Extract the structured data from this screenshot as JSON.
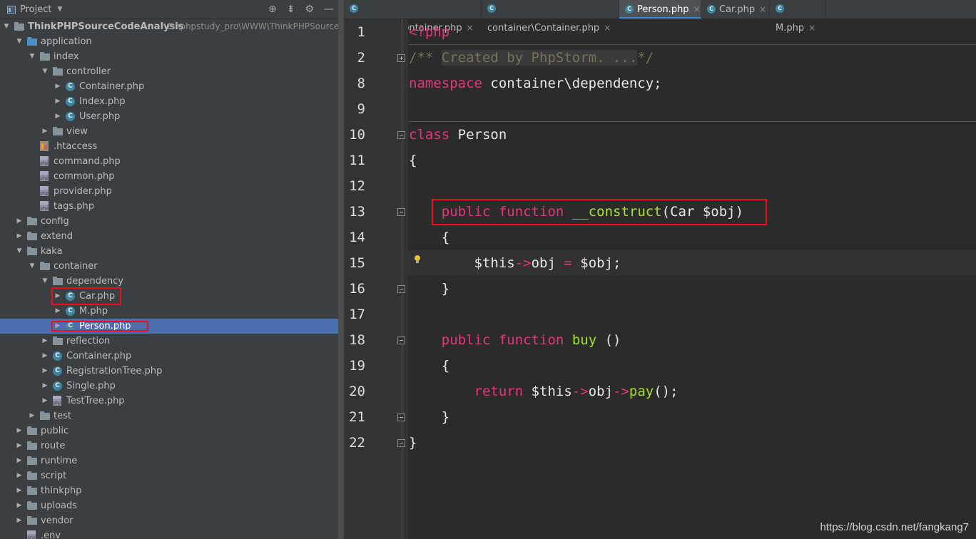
{
  "panel": {
    "title": "Project",
    "dropdown_glyph": "▼",
    "header_icons": [
      "target-icon",
      "collapse-icon",
      "gear-icon",
      "minimize-icon"
    ]
  },
  "tree": [
    {
      "label": "ThinkPHPSourceCodeAnalysis",
      "path": "D:\\phpstudy_pro\\WWW\\ThinkPHPSourceCo",
      "type": "root-folder",
      "depth": 0,
      "expanded": true
    },
    {
      "label": "application",
      "type": "folder-blue",
      "depth": 1,
      "expanded": true
    },
    {
      "label": "index",
      "type": "folder",
      "depth": 2,
      "expanded": true
    },
    {
      "label": "controller",
      "type": "folder",
      "depth": 3,
      "expanded": true
    },
    {
      "label": "Container.php",
      "type": "class",
      "depth": 4,
      "expanded": false
    },
    {
      "label": "Index.php",
      "type": "class",
      "depth": 4,
      "expanded": false
    },
    {
      "label": "User.php",
      "type": "class",
      "depth": 4,
      "expanded": false
    },
    {
      "label": "view",
      "type": "folder",
      "depth": 3,
      "expanded": false
    },
    {
      "label": ".htaccess",
      "type": "htaccess",
      "depth": 2
    },
    {
      "label": "command.php",
      "type": "php",
      "depth": 2
    },
    {
      "label": "common.php",
      "type": "php",
      "depth": 2
    },
    {
      "label": "provider.php",
      "type": "php",
      "depth": 2
    },
    {
      "label": "tags.php",
      "type": "php",
      "depth": 2
    },
    {
      "label": "config",
      "type": "folder",
      "depth": 1,
      "expanded": false
    },
    {
      "label": "extend",
      "type": "folder",
      "depth": 1,
      "expanded": false
    },
    {
      "label": "kaka",
      "type": "folder",
      "depth": 1,
      "expanded": true
    },
    {
      "label": "container",
      "type": "folder",
      "depth": 2,
      "expanded": true
    },
    {
      "label": "dependency",
      "type": "folder",
      "depth": 3,
      "expanded": true
    },
    {
      "label": "Car.php",
      "type": "class",
      "depth": 4,
      "expanded": false,
      "highlighted": true
    },
    {
      "label": "M.php",
      "type": "class",
      "depth": 4,
      "expanded": false
    },
    {
      "label": "Person.php",
      "type": "class",
      "depth": 4,
      "expanded": false,
      "selected": true,
      "highlighted": true
    },
    {
      "label": "reflection",
      "type": "folder",
      "depth": 3,
      "expanded": false
    },
    {
      "label": "Container.php",
      "type": "class",
      "depth": 3,
      "expanded": false
    },
    {
      "label": "RegistrationTree.php",
      "type": "class",
      "depth": 3,
      "expanded": false
    },
    {
      "label": "Single.php",
      "type": "class",
      "depth": 3,
      "expanded": false
    },
    {
      "label": "TestTree.php",
      "type": "php",
      "depth": 3,
      "expanded": false
    },
    {
      "label": "test",
      "type": "folder",
      "depth": 2,
      "expanded": false
    },
    {
      "label": "public",
      "type": "folder",
      "depth": 1,
      "expanded": false
    },
    {
      "label": "route",
      "type": "folder",
      "depth": 1,
      "expanded": false
    },
    {
      "label": "runtime",
      "type": "folder",
      "depth": 1,
      "expanded": false
    },
    {
      "label": "script",
      "type": "folder",
      "depth": 1,
      "expanded": false
    },
    {
      "label": "thinkphp",
      "type": "folder",
      "depth": 1,
      "expanded": false
    },
    {
      "label": "uploads",
      "type": "folder",
      "depth": 1,
      "expanded": false
    },
    {
      "label": "vendor",
      "type": "folder",
      "depth": 1,
      "expanded": false
    },
    {
      "label": ".env",
      "type": "php",
      "depth": 1
    }
  ],
  "tabs": [
    {
      "label": "controller\\Container.php",
      "active": false
    },
    {
      "label": "container\\Container.php",
      "active": false
    },
    {
      "label": "Person.php",
      "active": true
    },
    {
      "label": "Car.php",
      "active": false
    },
    {
      "label": "M.php",
      "active": false
    }
  ],
  "tab_close_glyph": "×",
  "tab_class_glyph": "C",
  "code_lines": [
    {
      "num": "1",
      "tokens": [
        {
          "t": "<?php",
          "c": "kw"
        }
      ]
    },
    {
      "num": "2",
      "tokens": [
        {
          "t": "/** ",
          "c": "cmt"
        },
        {
          "t": "Created by PhpStorm. ...",
          "c": "fold-txt"
        },
        {
          "t": "*/",
          "c": "cmt"
        }
      ]
    },
    {
      "num": "8",
      "tokens": [
        {
          "t": "namespace",
          "c": "kw"
        },
        {
          "t": " container\\dependency;",
          "c": ""
        }
      ]
    },
    {
      "num": "9",
      "tokens": []
    },
    {
      "num": "10",
      "tokens": [
        {
          "t": "class",
          "c": "kw"
        },
        {
          "t": " Person",
          "c": ""
        }
      ]
    },
    {
      "num": "11",
      "tokens": [
        {
          "t": "{",
          "c": ""
        }
      ]
    },
    {
      "num": "12",
      "tokens": []
    },
    {
      "num": "13",
      "tokens": [
        {
          "t": "    ",
          "c": ""
        },
        {
          "t": "public",
          "c": "kw"
        },
        {
          "t": " ",
          "c": ""
        },
        {
          "t": "function",
          "c": "kw"
        },
        {
          "t": " ",
          "c": ""
        },
        {
          "t": "__construct",
          "c": "fn"
        },
        {
          "t": "(Car $obj)",
          "c": ""
        }
      ]
    },
    {
      "num": "14",
      "tokens": [
        {
          "t": "    {",
          "c": ""
        }
      ]
    },
    {
      "num": "15",
      "tokens": [
        {
          "t": "        $this",
          "c": ""
        },
        {
          "t": "->",
          "c": "op"
        },
        {
          "t": "obj ",
          "c": ""
        },
        {
          "t": "=",
          "c": "op"
        },
        {
          "t": " $obj;",
          "c": ""
        }
      ]
    },
    {
      "num": "16",
      "tokens": [
        {
          "t": "    }",
          "c": ""
        }
      ]
    },
    {
      "num": "17",
      "tokens": []
    },
    {
      "num": "18",
      "tokens": [
        {
          "t": "    ",
          "c": ""
        },
        {
          "t": "public",
          "c": "kw"
        },
        {
          "t": " ",
          "c": ""
        },
        {
          "t": "function",
          "c": "kw"
        },
        {
          "t": " ",
          "c": ""
        },
        {
          "t": "buy",
          "c": "fn"
        },
        {
          "t": " ()",
          "c": ""
        }
      ]
    },
    {
      "num": "19",
      "tokens": [
        {
          "t": "    {",
          "c": ""
        }
      ]
    },
    {
      "num": "20",
      "tokens": [
        {
          "t": "        ",
          "c": ""
        },
        {
          "t": "return",
          "c": "kw"
        },
        {
          "t": " $this",
          "c": ""
        },
        {
          "t": "->",
          "c": "op"
        },
        {
          "t": "obj",
          "c": ""
        },
        {
          "t": "->",
          "c": "op"
        },
        {
          "t": "pay",
          "c": "fn"
        },
        {
          "t": "();",
          "c": ""
        }
      ]
    },
    {
      "num": "21",
      "tokens": [
        {
          "t": "    }",
          "c": ""
        }
      ]
    },
    {
      "num": "22",
      "tokens": [
        {
          "t": "}",
          "c": ""
        }
      ]
    }
  ],
  "current_line": "15",
  "watermark": "https://blog.csdn.net/fangkang7",
  "colors": {
    "keyword": "#e5357a",
    "function": "#a6e22e",
    "comment": "#75715e",
    "selection": "#4b6eaf",
    "highlight_box": "#e8101d"
  }
}
